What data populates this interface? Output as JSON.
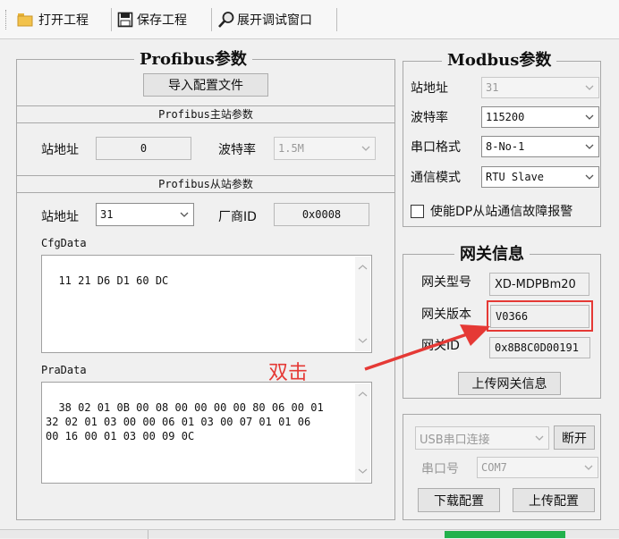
{
  "toolbar": {
    "open_project": "打开工程",
    "save_project": "保存工程",
    "expand_debug": "展开调试窗口"
  },
  "profibus": {
    "title": "Profibus参数",
    "import_button": "导入配置文件",
    "master_section": "Profibus主站参数",
    "master_station_label": "站地址",
    "master_station_value": "0",
    "baud_label": "波特率",
    "baud_value": "1.5M",
    "slave_section": "Profibus从站参数",
    "slave_station_label": "站地址",
    "slave_station_value": "31",
    "vendor_label": "厂商ID",
    "vendor_value": "0x0008",
    "cfg_label": "CfgData",
    "cfg_value": "11 21 D6 D1 60 DC",
    "pra_label": "PraData",
    "pra_value": "38 02 01 0B 00 08 00 00 00 00 80 06 00 01\n32 02 01 03 00 00 06 01 03 00 07 01 01 06\n00 16 00 01 03 00 09 0C"
  },
  "modbus": {
    "title": "Modbus参数",
    "station_label": "站地址",
    "station_value": "31",
    "baud_label": "波特率",
    "baud_value": "115200",
    "format_label": "串口格式",
    "format_value": "8-No-1",
    "mode_label": "通信模式",
    "mode_value": "RTU Slave",
    "alarm_label": "使能DP从站通信故障报警"
  },
  "gateway": {
    "title": "网关信息",
    "model_label": "网关型号",
    "model_value": "XD-MDPBm20",
    "version_label": "网关版本",
    "version_value": "V0366",
    "id_label": "网关ID",
    "id_value": "0x8B8C0D00191",
    "upload_button": "上传网关信息"
  },
  "connection": {
    "mode_value": "USB串口连接",
    "disconnect_button": "断开",
    "port_label": "串口号",
    "port_value": "COM7",
    "download_button": "下载配置",
    "upload_button": "上传配置"
  },
  "annotation": {
    "text": "双击",
    "color": "#e53935"
  },
  "colors": {
    "highlight": "#e53935",
    "status_green": "#22b14c"
  }
}
